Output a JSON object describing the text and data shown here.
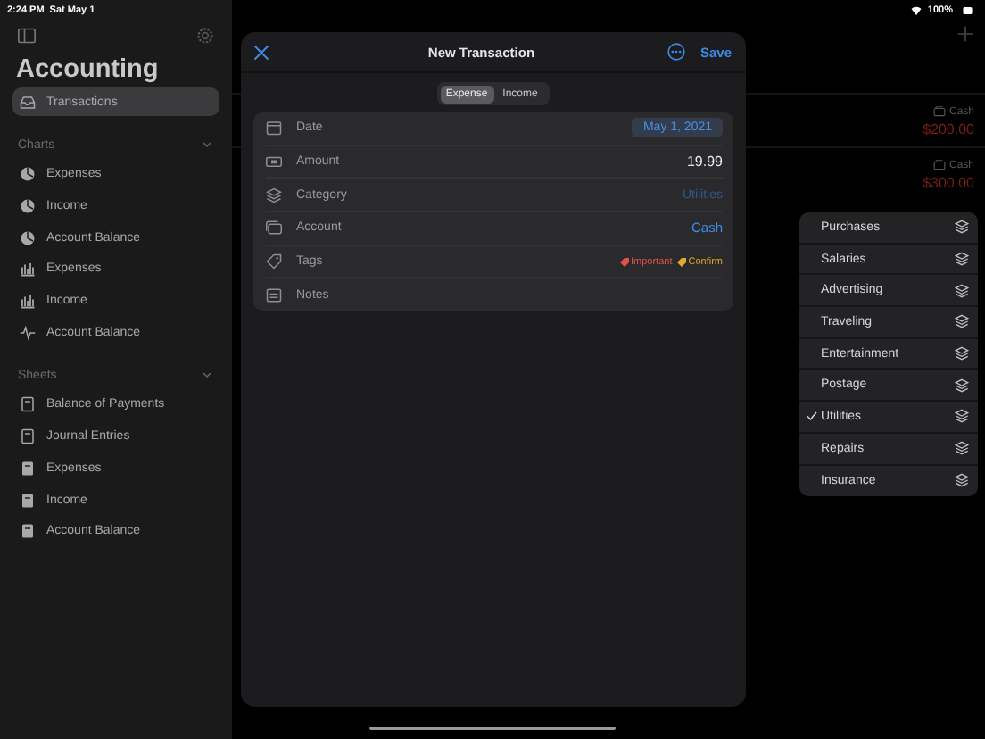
{
  "status_bar": {
    "time": "2:24 PM",
    "date": "Sat May 1",
    "battery": "100%"
  },
  "sidebar": {
    "title": "Accounting",
    "sections": [
      {
        "items": [
          {
            "label": "Transactions",
            "kind": "inbox",
            "selected": true
          }
        ]
      },
      {
        "title": "Charts",
        "expanded": true,
        "items": [
          {
            "label": "Expenses",
            "kind": "pie",
            "selected": false
          },
          {
            "label": "Income",
            "kind": "pie",
            "selected": false
          },
          {
            "label": "Account Balance",
            "kind": "pie",
            "selected": false
          },
          {
            "label": "Expenses",
            "kind": "bar",
            "selected": false
          },
          {
            "label": "Income",
            "kind": "bar",
            "selected": false
          },
          {
            "label": "Account Balance",
            "kind": "line",
            "selected": false
          }
        ]
      },
      {
        "title": "Sheets",
        "expanded": true,
        "items": [
          {
            "label": "Balance of Payments",
            "kind": "sheet",
            "selected": false
          },
          {
            "label": "Journal Entries",
            "kind": "sheet",
            "selected": false
          },
          {
            "label": "Expenses",
            "kind": "sheet-filled",
            "selected": false
          },
          {
            "label": "Income",
            "kind": "sheet-filled",
            "selected": false
          },
          {
            "label": "Account Balance",
            "kind": "sheet-filled",
            "selected": false
          }
        ]
      }
    ]
  },
  "list": {
    "rows": [
      {
        "account": "Cash",
        "amount": "$200.00"
      },
      {
        "account": "Cash",
        "amount": "$300.00"
      }
    ]
  },
  "sheet": {
    "title": "New Transaction",
    "save": "Save",
    "segments": [
      {
        "label": "Expense",
        "selected": true
      },
      {
        "label": "Income",
        "selected": false
      }
    ],
    "fields": [
      {
        "label": "Date",
        "kind": "date",
        "value": "May 1, 2021"
      },
      {
        "label": "Amount",
        "kind": "amount",
        "value": "19.99"
      },
      {
        "label": "Category",
        "kind": "category",
        "value": "Utilities"
      },
      {
        "label": "Account",
        "kind": "account",
        "value": "Cash"
      },
      {
        "label": "Tags",
        "kind": "tags",
        "tags": [
          {
            "label": "Important",
            "color": "#e0534a"
          },
          {
            "label": "Confirm",
            "color": "#e0a82e"
          }
        ]
      },
      {
        "label": "Notes",
        "kind": "notes"
      }
    ]
  },
  "menu": {
    "items": [
      {
        "label": "Purchases",
        "selected": false
      },
      {
        "label": "Salaries",
        "selected": false
      },
      {
        "label": "Advertising",
        "selected": false
      },
      {
        "label": "Traveling",
        "selected": false
      },
      {
        "label": "Entertainment",
        "selected": false
      },
      {
        "label": "Postage",
        "selected": false
      },
      {
        "label": "Utilities",
        "selected": true
      },
      {
        "label": "Repairs",
        "selected": false
      },
      {
        "label": "Insurance",
        "selected": false
      }
    ]
  }
}
